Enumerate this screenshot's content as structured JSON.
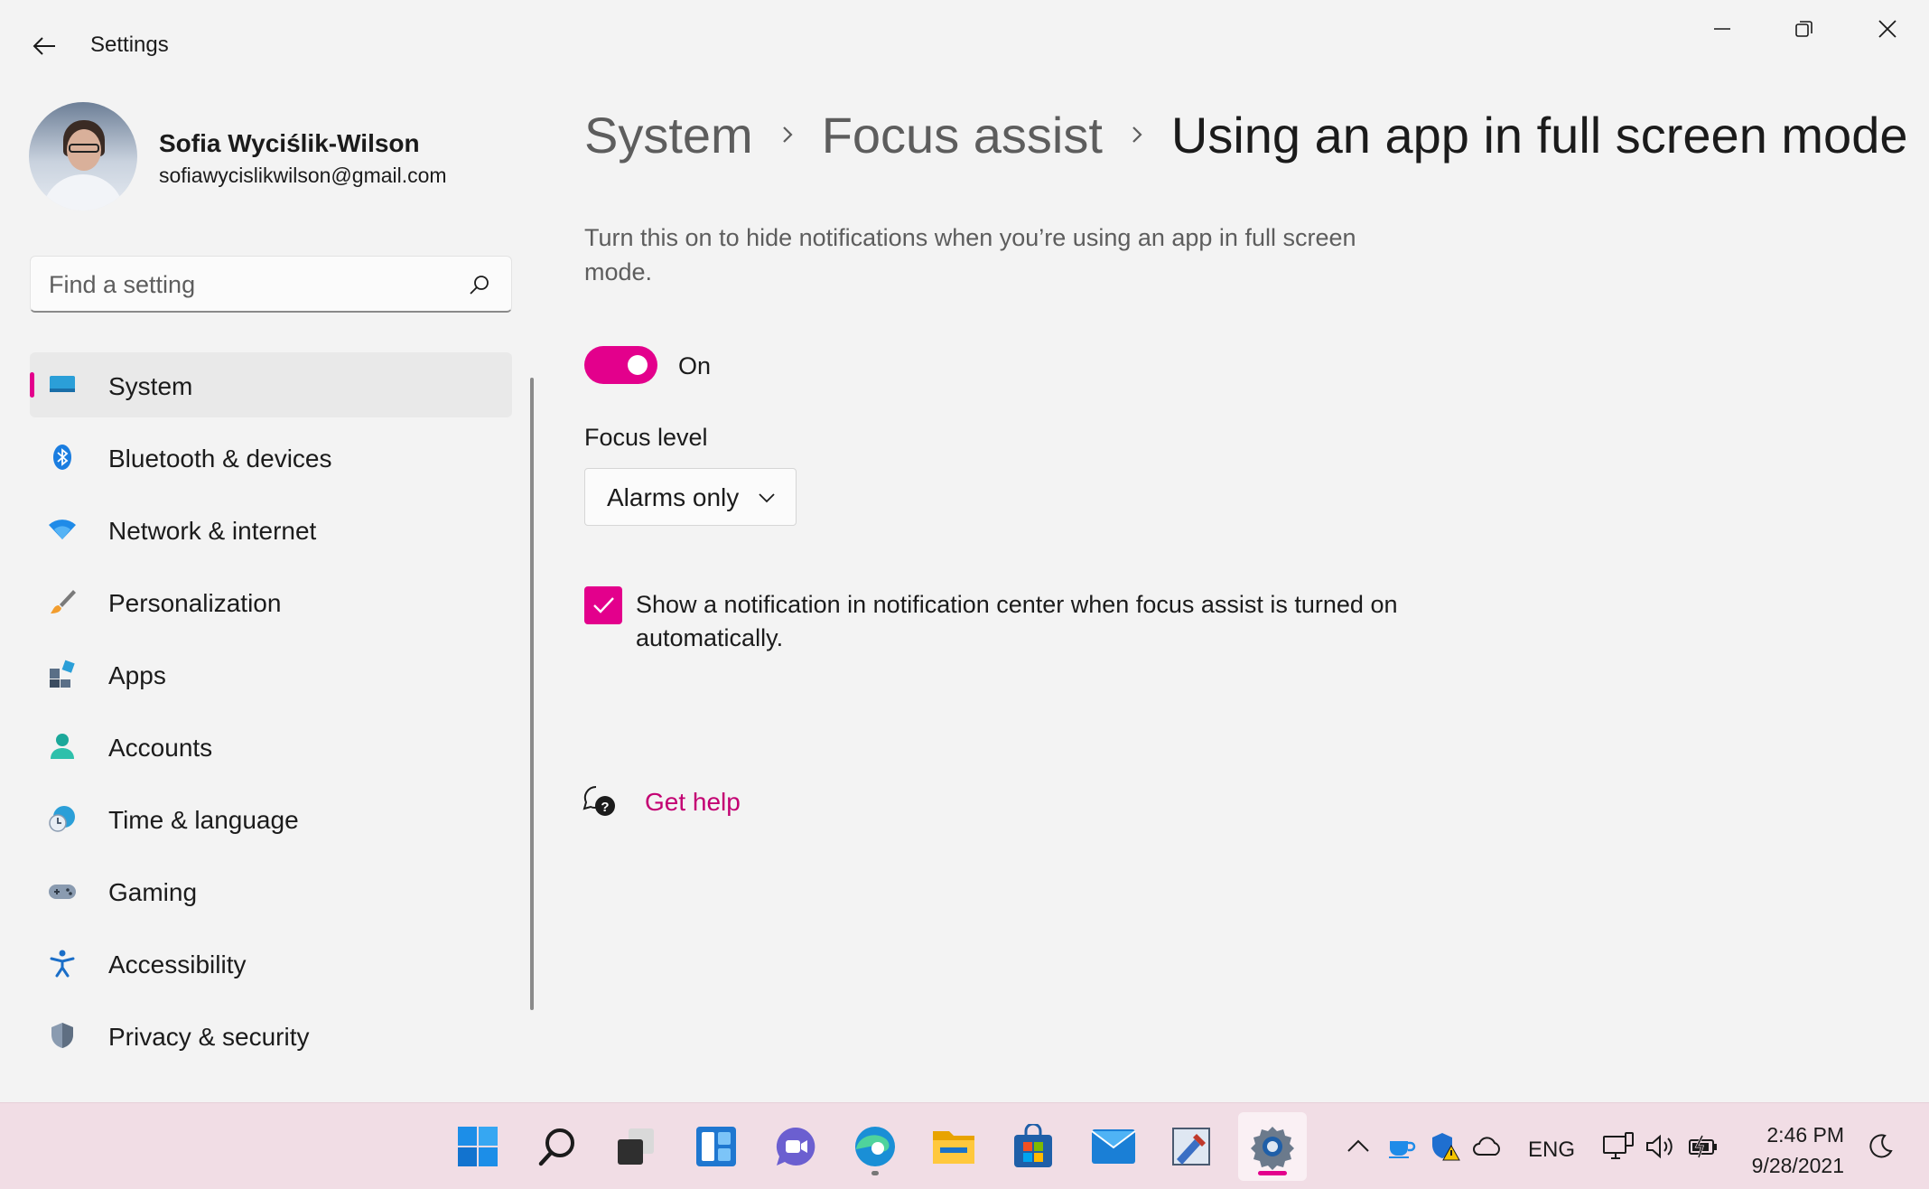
{
  "window": {
    "title": "Settings",
    "minimize_icon": "minimize-icon",
    "maximize_icon": "restore-icon",
    "close_icon": "close-icon"
  },
  "profile": {
    "name": "Sofia Wyciślik-Wilson",
    "email": "sofiawycislikwilson@gmail.com"
  },
  "search": {
    "placeholder": "Find a setting",
    "value": ""
  },
  "sidebar": {
    "items": [
      {
        "label": "System",
        "icon": "system-display-icon",
        "active": true
      },
      {
        "label": "Bluetooth & devices",
        "icon": "bluetooth-icon"
      },
      {
        "label": "Network & internet",
        "icon": "wifi-icon"
      },
      {
        "label": "Personalization",
        "icon": "paintbrush-icon"
      },
      {
        "label": "Apps",
        "icon": "apps-icon"
      },
      {
        "label": "Accounts",
        "icon": "person-icon"
      },
      {
        "label": "Time & language",
        "icon": "clock-globe-icon"
      },
      {
        "label": "Gaming",
        "icon": "gamepad-icon"
      },
      {
        "label": "Accessibility",
        "icon": "accessibility-icon"
      },
      {
        "label": "Privacy & security",
        "icon": "shield-icon"
      }
    ]
  },
  "breadcrumb": {
    "items": [
      "System",
      "Focus assist"
    ],
    "current": "Using an app in full screen mode"
  },
  "main": {
    "description": "Turn this on to hide notifications when you’re using an app in full screen mode.",
    "toggle": {
      "state": "On",
      "on": true
    },
    "focus_level": {
      "label": "Focus level",
      "selected": "Alarms only"
    },
    "checkbox": {
      "checked": true,
      "label": "Show a notification in notification center when focus assist is turned on automatically."
    },
    "help": {
      "label": "Get help"
    }
  },
  "taskbar": {
    "apps": [
      "start-icon",
      "search-icon",
      "task-view-icon",
      "widgets-icon",
      "teams-chat-icon",
      "edge-icon",
      "file-explorer-icon",
      "microsoft-store-icon",
      "mail-icon",
      "paint-icon",
      "settings-gear-icon"
    ],
    "tray": {
      "language": "ENG",
      "time": "2:46 PM",
      "date": "9/28/2021"
    }
  },
  "colors": {
    "accent": "#e3008c",
    "link": "#c30072",
    "background": "#f3f3f3",
    "taskbar": "#f1dde5"
  }
}
